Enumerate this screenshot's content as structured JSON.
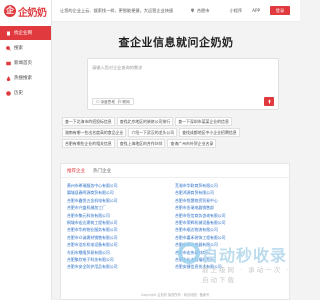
{
  "brand": {
    "name": "企奶奶",
    "mark": "企"
  },
  "sidebar": {
    "items": [
      {
        "label": "找企业网",
        "icon": "building-icon",
        "active": true
      },
      {
        "label": "搜索",
        "icon": "search-icon",
        "active": false
      },
      {
        "label": "新闻首页",
        "icon": "news-icon",
        "active": false
      },
      {
        "label": "热搜搜索",
        "icon": "hot-icon",
        "active": false
      },
      {
        "label": "历史",
        "icon": "history-icon",
        "active": false
      }
    ]
  },
  "topbar": {
    "slogan": "让您的企业上云、搜索找一样，更智能便捷，大运营企业快速",
    "city": "合肥市",
    "miniprogram": "小程序",
    "app": "APP",
    "login": "登录"
  },
  "hero": {
    "title": "查企业信息就问企奶奶"
  },
  "search": {
    "placeholder": "请输入您对企业查询的需求",
    "option1": "深度思考",
    "option2": "联网",
    "button_icon": "send-icon"
  },
  "tags": [
    "查一下北海市的招投标信息",
    "查找北京地区的装修公司排行",
    "查一下深圳市某某企业的信息",
    "湖南有哪一些出名度高的食品企业",
    "介绍一下武汉的龙头公司",
    "查找成都地区中小企业招聘信息",
    "合肥有哪些企业的相关信息",
    "查找上海地区的合作伙伴",
    "查询广州市外贸企业名录"
  ],
  "panel": {
    "tabs": [
      "推荐企业",
      "热门企业"
    ],
    "left": [
      "黄州市希瑞服务中心有限公司",
      "翼城县春晖源商贸有限公司",
      "合肥市鑫悦五金机电有限公司",
      "合肥市兴盛机械加工厂",
      "合肥市聚元科技有限公司",
      "桐城市宏达建筑工程有限公司",
      "合肥市华府物业服务有限公司",
      "合肥市众诚建材销售有限公司",
      "合肥市浩东机电设备有限公司",
      "东阳市鼎隆贸易有限公司",
      "合肥聚欣电子科技有限公司",
      "合肥市安全防护用品有限公司"
    ],
    "right": [
      "芜湖市华联商贸有限公司",
      "合肥鸿源商贸有限公司",
      "合肥市悦晟物资贸易中心",
      "合肥市金瑞电器销售部",
      "合肥市恒信商务咨询有限公司",
      "合肥市荣辉机械设备有限公司",
      "合肥市顺达物流有限公司",
      "合肥市嘉禾装饰工程有限公司",
      "合肥市永兴电器有限公司",
      "合肥市宏伟建材商行",
      "合肥市长丰县福临超市",
      "合肥安捷信息技术有限公司"
    ]
  },
  "watermark": {
    "title": "自动秒收录",
    "subtitle": "散上级网 · 承动一次 · 自动下载"
  },
  "footer": "Copyright 企奶奶 版权所有 · 网站地图 · 备案号"
}
